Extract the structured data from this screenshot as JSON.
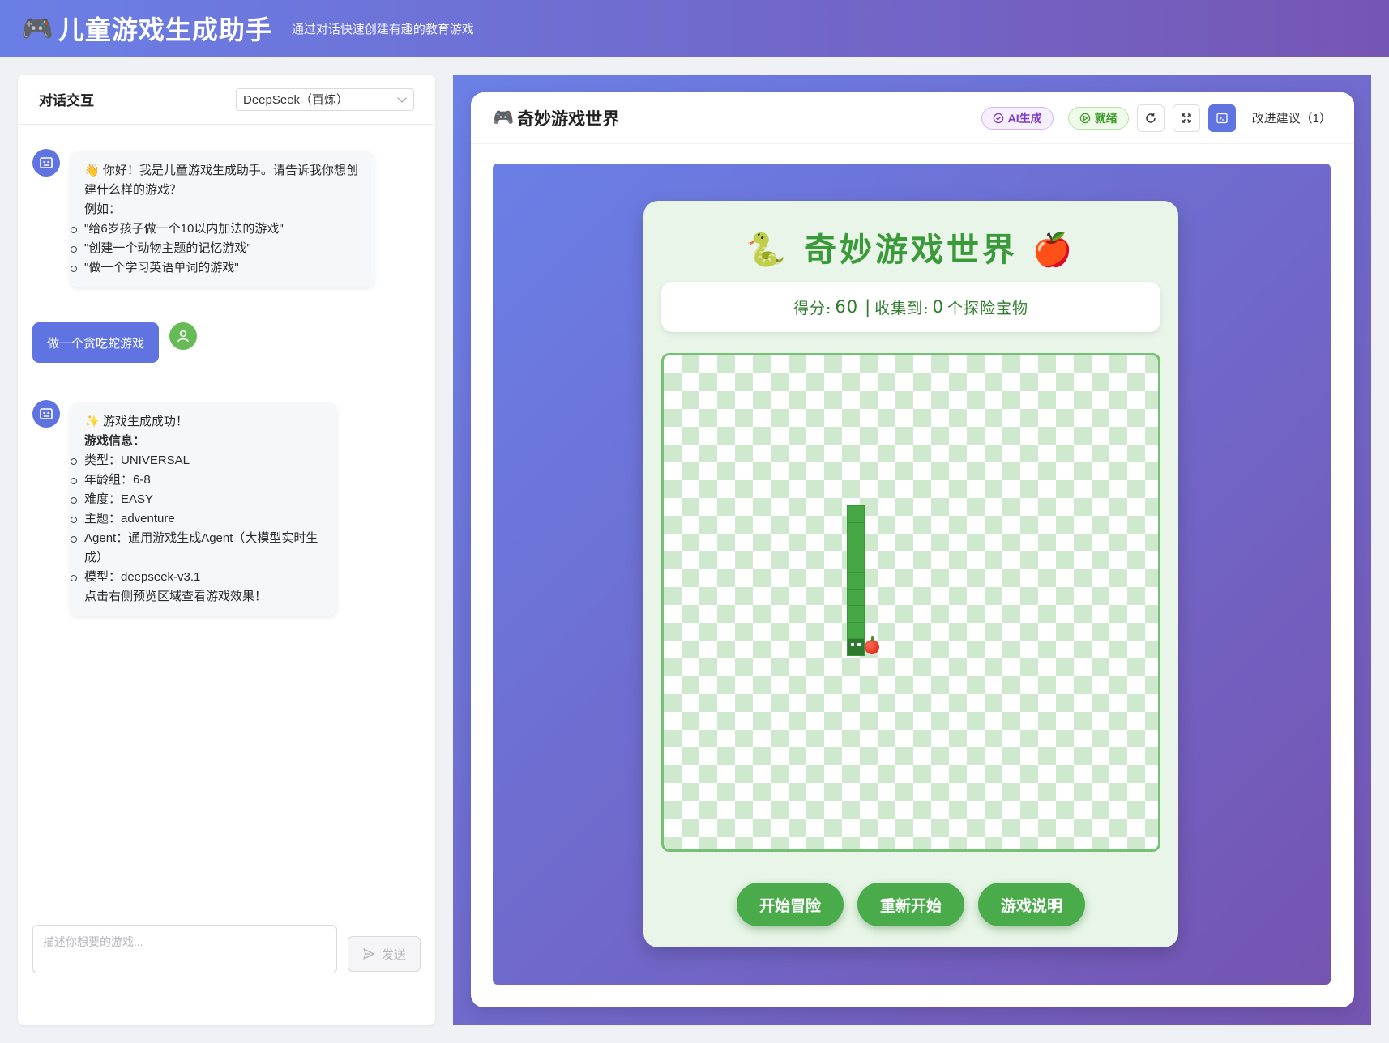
{
  "header": {
    "logo": "🎮",
    "title": "儿童游戏生成助手",
    "subtitle": "通过对话快速创建有趣的教育游戏"
  },
  "chat": {
    "title": "对话交互",
    "model_selected": "DeepSeek（百炼）",
    "messages": [
      {
        "role": "bot",
        "greeting": "👋 你好！我是儿童游戏生成助手。请告诉我你想创建什么样的游戏？",
        "example_label": "例如：",
        "examples": [
          "\"给6岁孩子做一个10以内加法的游戏\"",
          "\"创建一个动物主题的记忆游戏\"",
          "\"做一个学习英语单词的游戏\""
        ]
      },
      {
        "role": "user",
        "text": "做一个贪吃蛇游戏"
      },
      {
        "role": "bot",
        "success": "✨ 游戏生成成功！",
        "info_label": "游戏信息：",
        "info": [
          "类型：UNIVERSAL",
          "年龄组：6-8",
          "难度：EASY",
          "主题：adventure",
          "Agent：通用游戏生成Agent（大模型实时生成）",
          "模型：deepseek-v3.1"
        ],
        "footer": "点击右侧预览区域查看游戏效果！"
      }
    ],
    "input_placeholder": "描述你想要的游戏...",
    "send_label": "发送"
  },
  "preview": {
    "title_icon": "🎮",
    "title": "奇妙游戏世界",
    "tag_ai": "AI生成",
    "tag_status": "就绪",
    "improve_label": "改进建议（1）"
  },
  "game": {
    "title": "🐍 奇妙游戏世界 🍎",
    "score_label": "得分:",
    "score": "60",
    "separator": "|",
    "collected_label": "收集到:",
    "collected": "0",
    "collected_suffix": "个探险宝物",
    "snake_length": 9,
    "buttons": {
      "start": "开始冒险",
      "restart": "重新开始",
      "help": "游戏说明"
    }
  },
  "colors": {
    "header_gradient_start": "#6a7fe6",
    "header_gradient_end": "#7656b4",
    "accent": "#5f74e0",
    "user_avatar": "#66bb55",
    "game_green": "#4aab4a",
    "board_light": "#cfe9cf"
  }
}
